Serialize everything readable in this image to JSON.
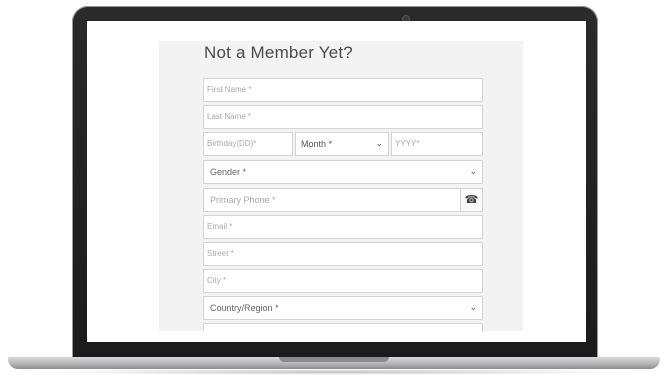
{
  "form": {
    "title": "Not a Member Yet?",
    "fields": {
      "first_name": "First Name *",
      "last_name": "Last Name *",
      "birthday_day": "Birthday(DD)*",
      "birthday_month": "Month *",
      "birthday_year": "YYYY*",
      "gender": "Gender *",
      "primary_phone": "Primary Phone *",
      "email": "Email *",
      "street": "Street *",
      "city": "City *",
      "country_region": "Country/Region *"
    }
  },
  "icons": {
    "chevron": "chevron-down-icon",
    "phone": "phone-icon"
  }
}
